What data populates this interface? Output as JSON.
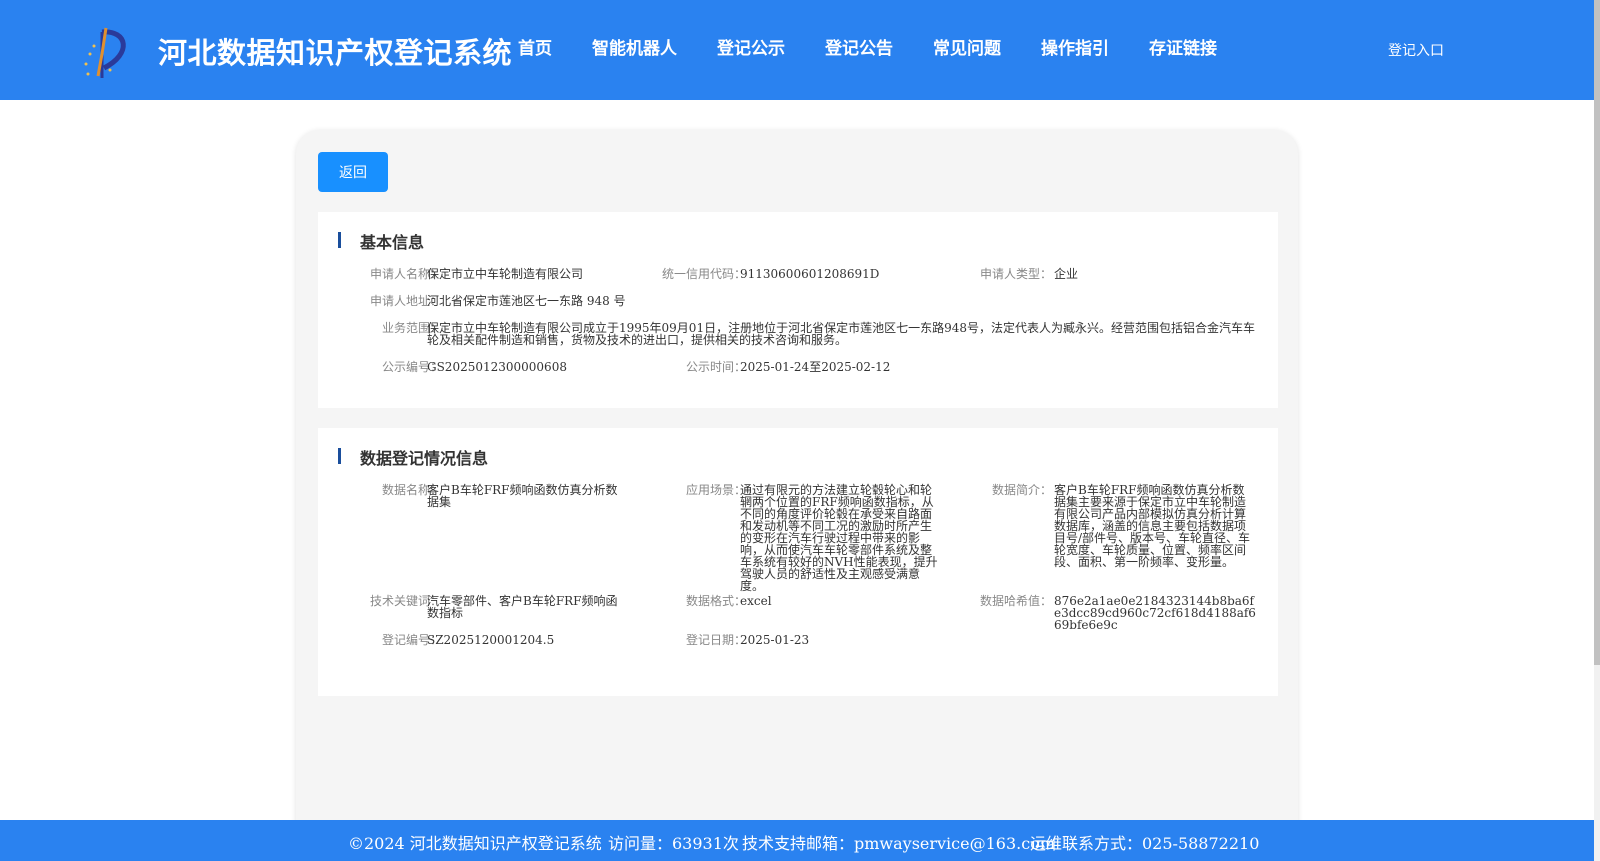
{
  "header": {
    "title": "河北数据知识产权登记系统",
    "nav": [
      "首页",
      "智能机器人",
      "登记公示",
      "登记公告",
      "常见问题",
      "操作指引",
      "存证链接"
    ],
    "login": "登记入口",
    "logo_icon": "ip-logo-icon"
  },
  "back_button": "返回",
  "basic_info": {
    "title": "基本信息",
    "applicant_name_label": "申请人名称：",
    "applicant_name": "保定市立中车轮制造有限公司",
    "credit_code_label": "统一信用代码：",
    "credit_code": "91130600601208691D",
    "applicant_type_label": "申请人类型：",
    "applicant_type": "企业",
    "address_label": "申请人地址：",
    "address": "河北省保定市莲池区七一东路 948 号",
    "business_scope_label": "业务范围：",
    "business_scope": "保定市立中车轮制造有限公司成立于1995年09月01日，注册地位于河北省保定市莲池区七一东路948号，法定代表人为臧永兴。经营范围包括铝合金汽车车轮及相关配件制造和销售，货物及技术的进出口，提供相关的技术咨询和服务。",
    "public_no_label": "公示编号：",
    "public_no": "GS2025012300000608",
    "public_time_label": "公示时间：",
    "public_time": "2025-01-24至2025-02-12"
  },
  "data_info": {
    "title": "数据登记情况信息",
    "data_name_label": "数据名称：",
    "data_name": "客户B车轮FRF频响函数仿真分析数据集",
    "scenario_label": "应用场景：",
    "scenario": "通过有限元的方法建立轮毂轮心和轮辋两个位置的FRF频响函数指标，从不同的角度评价轮毂在承受来自路面和发动机等不同工况的激励时所产生的变形在汽车行驶过程中带来的影响，从而使汽车车轮零部件系统及整车系统有较好的NVH性能表现，提升驾驶人员的舒适性及主观感受满意度。",
    "summary_label": "数据简介：",
    "summary": "客户B车轮FRF频响函数仿真分析数据集主要来源于保定市立中车轮制造有限公司产品内部模拟仿真分析计算数据库，涵盖的信息主要包括数据项目号/部件号、版本号、车轮直径、车轮宽度、车轮质量、位置、频率区间段、面积、第一阶频率、变形量。",
    "keywords_label": "技术关键词：",
    "keywords": "汽车零部件、客户B车轮FRF频响函数指标",
    "format_label": "数据格式：",
    "format": "excel",
    "hash_label": "数据哈希值：",
    "hash": "876e2a1ae0e2184323144b8ba6fe3dcc89cd960c72cf618d4188af669bfe6e9c",
    "reg_no_label": "登记编号：",
    "reg_no": "SZ2025120001204.5",
    "reg_date_label": "登记日期：",
    "reg_date": "2025-01-23"
  },
  "footer": {
    "copyright": "©2024 河北数据知识产权登记系统",
    "visits": "访问量：63931次",
    "email": "技术支持邮箱：pmwayservice@163.com",
    "phone": "运维联系方式：025-58872210"
  },
  "colors": {
    "primary": "#2a82f0",
    "button": "#1890ff",
    "section_bar": "#1a4e9c"
  }
}
